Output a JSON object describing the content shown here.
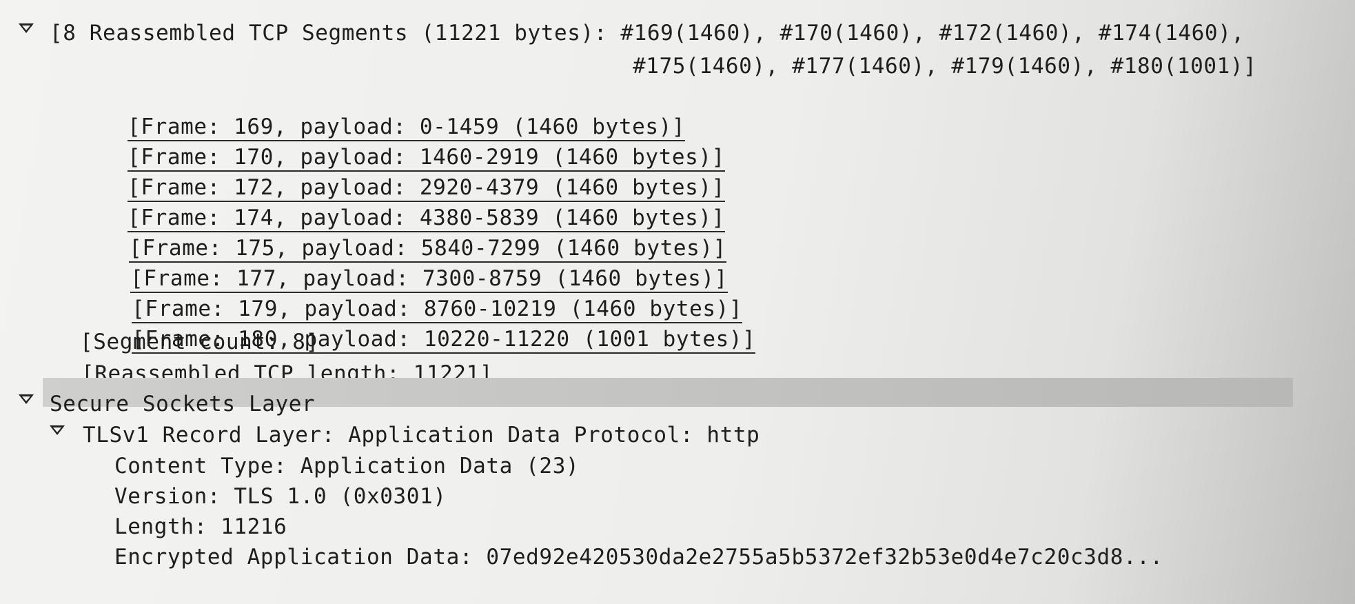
{
  "tree": {
    "reassembled": {
      "label_line1": "[8 Reassembled TCP Segments (11221 bytes): #169(1460), #170(1460), #172(1460), #174(1460),",
      "label_line2": "#175(1460), #177(1460), #179(1460), #180(1001)]",
      "expanded": true,
      "frames": [
        "[Frame: 169, payload: 0-1459 (1460 bytes)]",
        "[Frame: 170, payload: 1460-2919 (1460 bytes)]",
        "[Frame: 172, payload: 2920-4379 (1460 bytes)]",
        "[Frame: 174, payload: 4380-5839 (1460 bytes)]",
        "[Frame: 175, payload: 5840-7299 (1460 bytes)]",
        "[Frame: 177, payload: 7300-8759 (1460 bytes)]",
        "[Frame: 179, payload: 8760-10219 (1460 bytes)]",
        "[Frame: 180, payload: 10220-11220 (1001 bytes)]"
      ],
      "segment_count": "[Segment count: 8]",
      "reassembled_length": "[Reassembled TCP length: 11221]"
    },
    "ssl": {
      "label": "Secure Sockets Layer",
      "expanded": true,
      "selected": true,
      "record": {
        "label": "TLSv1 Record Layer: Application Data Protocol: http",
        "expanded": true,
        "fields": {
          "content_type": "Content Type: Application Data (23)",
          "version": "Version: TLS 1.0 (0x0301)",
          "length": "Length: 11216",
          "encrypted_data": "Encrypted Application Data: 07ed92e420530da2e2755a5b5372ef32b53e0d4e7c20c3d8..."
        }
      }
    }
  }
}
